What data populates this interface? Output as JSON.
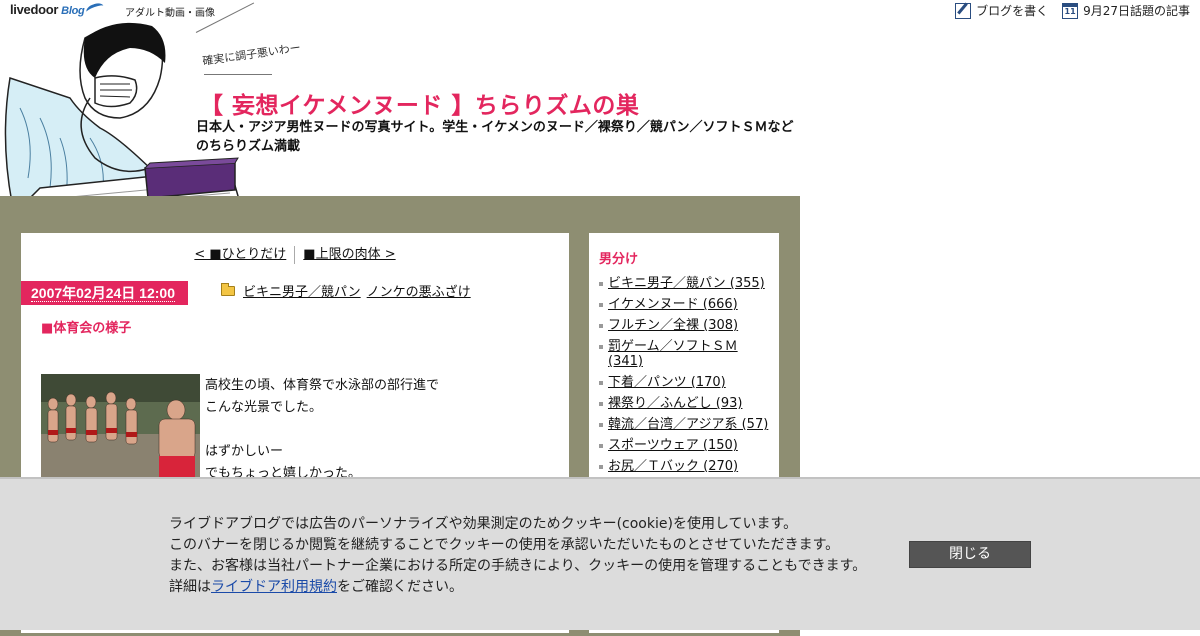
{
  "topbar": {
    "logo": "livedoor",
    "logo_sub": "Blog",
    "category_link": "アダルト動画・画像",
    "write_blog": "ブログを書く",
    "trending": "9月27日話題の記事",
    "calendar_day": "11"
  },
  "header": {
    "tagline": "確実に調子悪いわー",
    "title": "【 妄想イケメンヌード 】ちらりズムの巣",
    "description": "日本人・アジア男性ヌードの写真サイト。学生・イケメンのヌード／裸祭り／競パン／ソフトＳＭなどのちらりズム満載"
  },
  "post": {
    "prev_link": "< ■ひとりだけ",
    "next_link": "■上限の肉体 >",
    "date": "2007年02月24日 12:00",
    "categories": [
      "ビキニ男子／競パン",
      "ノンケの悪ふざけ"
    ],
    "title": "■体育会の様子",
    "body": [
      "高校生の頃、体育祭で水泳部の部行進で",
      "こんな光景でした。",
      "",
      "はずかしいー",
      "でもちょっと嬉しかった。"
    ]
  },
  "sidebar": {
    "title": "男分け",
    "items": [
      "ビキニ男子／競パン (355)",
      "イケメンヌード (666)",
      "フルチン／全裸 (308)",
      "罰ゲーム／ソフトＳＭ (341)",
      "下着／パンツ (170)",
      "裸祭り／ふんどし (93)",
      "韓流／台湾／アジア系 (57)",
      "スポーツウェア (150)",
      "お尻／Ｔバック (270)"
    ]
  },
  "cookie": {
    "line1": "ライブドアブログでは広告のパーソナライズや効果測定のためクッキー(cookie)を使用しています。",
    "line2": "このバナーを閉じるか閲覧を継続することでクッキーの使用を承認いただいたものとさせていただきます。",
    "line3": "また、お客様は当社パートナー企業における所定の手続きにより、クッキーの使用を管理することもできます。",
    "line4_prefix": "詳細は",
    "line4_link": "ライブドア利用規約",
    "line4_suffix": "をご確認ください。",
    "close_label": "閉じる"
  }
}
